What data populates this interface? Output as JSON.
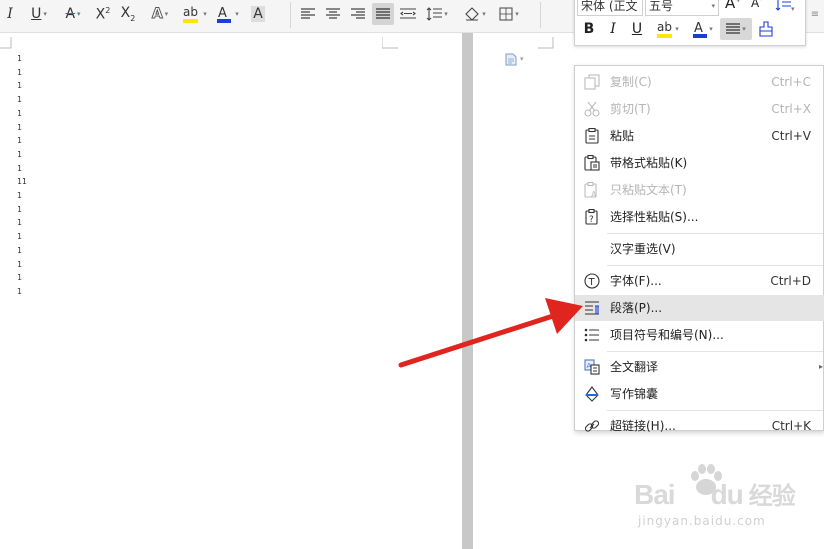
{
  "toolbar": {
    "font_size_buttons": [
      "A",
      "A"
    ]
  },
  "mini_toolbar": {
    "font_name": "宋体 (正文",
    "font_size": "五号",
    "bold": "B",
    "italic": "I",
    "underline": "U",
    "grow_font": "A",
    "shrink_font": "A"
  },
  "document": {
    "line_numbers": [
      "1",
      "1",
      "1",
      "1",
      "1",
      "1",
      "1",
      "1",
      "1",
      "11",
      "1",
      "1",
      "1",
      "1",
      "1",
      "1",
      "1",
      "1"
    ]
  },
  "context_menu": {
    "items": [
      {
        "label": "复制(C)",
        "shortcut": "Ctrl+C",
        "icon": "copy-icon",
        "enabled": false
      },
      {
        "label": "剪切(T)",
        "shortcut": "Ctrl+X",
        "icon": "scissors-icon",
        "enabled": false
      },
      {
        "label": "粘贴",
        "shortcut": "Ctrl+V",
        "icon": "paste-icon",
        "enabled": true
      },
      {
        "label": "带格式粘贴(K)",
        "shortcut": "",
        "icon": "paste-format-icon",
        "enabled": true
      },
      {
        "label": "只粘贴文本(T)",
        "shortcut": "",
        "icon": "paste-text-icon",
        "enabled": false
      },
      {
        "label": "选择性粘贴(S)...",
        "shortcut": "",
        "icon": "paste-special-icon",
        "enabled": true
      },
      {
        "label": "汉字重选(V)",
        "shortcut": "",
        "icon": "",
        "enabled": true
      },
      {
        "label": "字体(F)...",
        "shortcut": "Ctrl+D",
        "icon": "font-icon",
        "enabled": true
      },
      {
        "label": "段落(P)...",
        "shortcut": "",
        "icon": "paragraph-icon",
        "enabled": true,
        "highlighted": true
      },
      {
        "label": "项目符号和编号(N)...",
        "shortcut": "",
        "icon": "bullet-list-icon",
        "enabled": true
      },
      {
        "label": "全文翻译",
        "shortcut": "",
        "icon": "translate-icon",
        "enabled": true,
        "submenu": true
      },
      {
        "label": "写作锦囊",
        "shortcut": "",
        "icon": "writing-tips-icon",
        "enabled": true
      },
      {
        "label": "超链接(H)...",
        "shortcut": "Ctrl+K",
        "icon": "link-icon",
        "enabled": true
      }
    ]
  },
  "watermark": {
    "brand_latin": "Bai",
    "brand_mid": "du",
    "brand_cn": "经验",
    "url": "jingyan.baidu.com"
  },
  "colors": {
    "arrow": "#e0241e",
    "font_color_bar": "#1a3fd4",
    "highlight_bar": "#ffe600",
    "menu_highlight": "#e5e5e5"
  }
}
